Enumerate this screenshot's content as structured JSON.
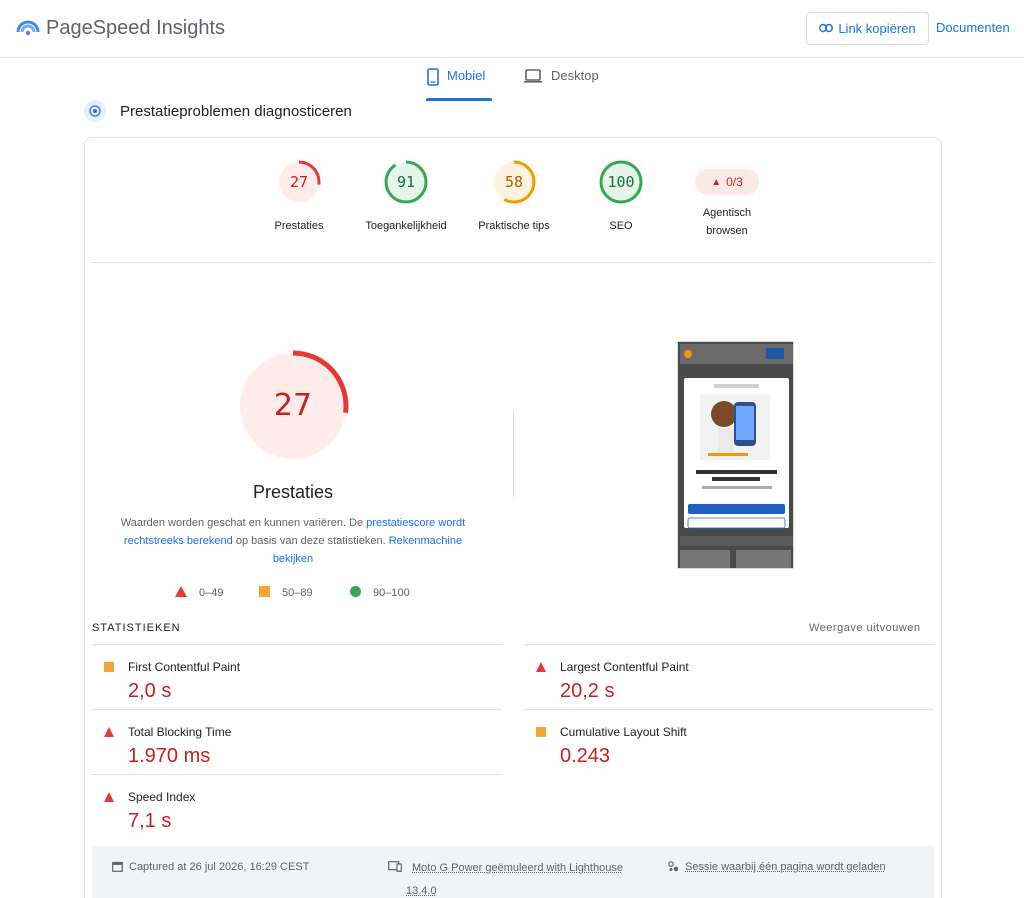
{
  "header": {
    "brand_title": "PageSpeed Insights",
    "copy_link_label": "Link kopiëren",
    "docs_label": "Documenten"
  },
  "tabs": [
    {
      "label": "Mobiel",
      "icon": "smartphone-icon",
      "active": true
    },
    {
      "label": "Desktop",
      "icon": "laptop-icon",
      "active": false
    }
  ],
  "diagnose_title": "Prestatieproblemen diagnosticeren",
  "categories": [
    {
      "label": "Prestaties",
      "score": "27",
      "fraction": 0.27,
      "color": "#e53935"
    },
    {
      "label": "Toegankelijkheid",
      "score": "91",
      "fraction": 0.91,
      "color": "#34a853"
    },
    {
      "label": "Praktische tips",
      "score": "58",
      "fraction": 0.58,
      "color": "#f29900"
    },
    {
      "label": "SEO",
      "score": "100",
      "fraction": 1.0,
      "color": "#34a853"
    },
    {
      "label": "Agentisch browsen",
      "score": "0/3",
      "badge": true,
      "color": "#c5221f"
    }
  ],
  "performance": {
    "score": "27",
    "fraction": 0.27,
    "title": "Prestaties",
    "desc_prefix": "Waarden worden geschat en kunnen variëren. De ",
    "desc_link1": "prestatiescore wordt rechtstreeks berekend",
    "desc_middle": " op basis van deze statistieken. ",
    "desc_link2": "Rekenmachine bekijken"
  },
  "legend": [
    {
      "range": "0–49",
      "shape": "triangle",
      "color": "#e53935"
    },
    {
      "range": "50–89",
      "shape": "square",
      "color": "#f4a53a"
    },
    {
      "range": "90–100",
      "shape": "circle",
      "color": "#34a853"
    }
  ],
  "stats": {
    "label": "STATISTIEKEN",
    "expand_label": "Weergave uitvouwen",
    "metrics": [
      {
        "name": "First Contentful Paint",
        "value": "2,0 s",
        "status": "average"
      },
      {
        "name": "Largest Contentful Paint",
        "value": "20,2 s",
        "status": "fail"
      },
      {
        "name": "Total Blocking Time",
        "value": "1.970 ms",
        "status": "fail"
      },
      {
        "name": "Cumulative Layout Shift",
        "value": "0.243",
        "status": "average"
      },
      {
        "name": "Speed Index",
        "value": "7,1 s",
        "status": "fail"
      }
    ]
  },
  "footer": {
    "captured": "Captured at 26 jul 2026, 16:29 CEST",
    "device": "Moto G Power geëmuleerd with Lighthouse",
    "lighthouse_version": "13.4.0",
    "session": "Sessie waarbij één pagina wordt geladen"
  },
  "colors": {
    "accent": "#1a73e8",
    "fail": "#c5221f",
    "average": "#f4a53a",
    "pass": "#34a853"
  }
}
